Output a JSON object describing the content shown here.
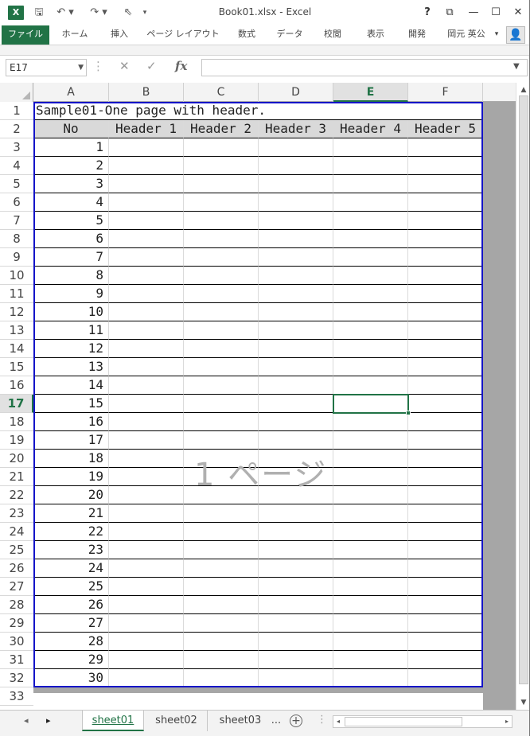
{
  "window": {
    "title": "Book01.xlsx - Excel",
    "icons": [
      "excel-logo-icon",
      "save-icon",
      "undo-icon",
      "redo-icon",
      "pointer-icon",
      "customize-icon"
    ],
    "help": "?",
    "ribbon_display": "⧉",
    "minimize": "—",
    "maximize": "☐",
    "close": "✕"
  },
  "ribbon": {
    "tabs": [
      "ファイル",
      "ホーム",
      "挿入",
      "ページ レイアウト",
      "数式",
      "データ",
      "校閲",
      "表示",
      "開発"
    ],
    "user": "岡元 英公",
    "user_menu": "▾"
  },
  "formula_bar": {
    "name_box": "E17",
    "cancel": "✕",
    "enter": "✓",
    "fx": "fx",
    "value": ""
  },
  "columns": [
    "A",
    "B",
    "C",
    "D",
    "E",
    "F"
  ],
  "selected_column": "E",
  "selected_row": 17,
  "row_numbers": [
    1,
    2,
    3,
    4,
    5,
    6,
    7,
    8,
    9,
    10,
    11,
    12,
    13,
    14,
    15,
    16,
    17,
    18,
    19,
    20,
    21,
    22,
    23,
    24,
    25,
    26,
    27,
    28,
    29,
    30,
    31,
    32,
    33
  ],
  "sheet": {
    "title_cell": "Sample01-One page with header.",
    "headers": [
      "No",
      "Header 1",
      "Header 2",
      "Header 3",
      "Header 4",
      "Header 5"
    ],
    "rows": [
      1,
      2,
      3,
      4,
      5,
      6,
      7,
      8,
      9,
      10,
      11,
      12,
      13,
      14,
      15,
      16,
      17,
      18,
      19,
      20,
      21,
      22,
      23,
      24,
      25,
      26,
      27,
      28,
      29,
      30
    ]
  },
  "page_watermark": "1 ページ",
  "sheet_tabs": {
    "prev": "◂",
    "next": "▸",
    "tabs": [
      "sheet01",
      "sheet02",
      "sheet03"
    ],
    "more": "...",
    "add": "+"
  }
}
